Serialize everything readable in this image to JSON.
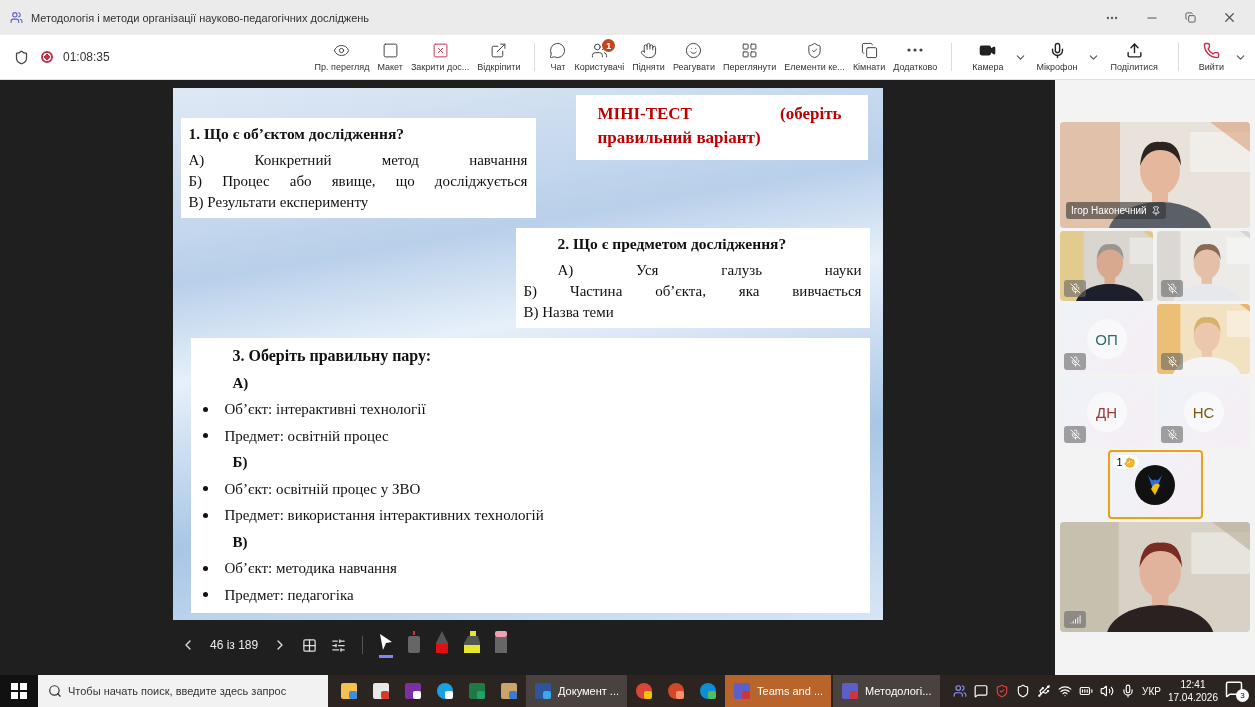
{
  "window": {
    "title": "Методологія і методи організації науково-педагогічних досліджень"
  },
  "meeting_bar": {
    "recording": true,
    "timer": "01:08:35",
    "buttons": [
      {
        "kind": "eye",
        "label": "Пр. перегляд"
      },
      {
        "kind": "layout",
        "label": "Макет"
      },
      {
        "kind": "stop",
        "label": "Закрити дос..."
      },
      {
        "kind": "popout",
        "label": "Відкріпити"
      },
      {
        "kind": "chat",
        "label": "Чат"
      },
      {
        "kind": "people",
        "label": "Користувачі",
        "badge": "1"
      },
      {
        "kind": "hand",
        "label": "Підняти"
      },
      {
        "kind": "react",
        "label": "Реагувати"
      },
      {
        "kind": "view",
        "label": "Переглянути"
      },
      {
        "kind": "controls",
        "label": "Елементи ке..."
      },
      {
        "kind": "rooms",
        "label": "Кімнати"
      },
      {
        "kind": "more",
        "label": "Додатково"
      }
    ],
    "devices": [
      {
        "kind": "camera",
        "label": "Камера",
        "dropdown": true
      },
      {
        "kind": "mic",
        "label": "Мікрофон",
        "dropdown": true
      },
      {
        "kind": "share",
        "label": "Поділитися",
        "dropdown": false
      },
      {
        "kind": "leave",
        "label": "Вийти",
        "dropdown": true
      }
    ]
  },
  "slide": {
    "title": "МІНІ-ТЕСТ (оберіть правильний варіант)",
    "questions": [
      {
        "title": "1. Що є об’єктом дослідження?",
        "options": [
          "А) Конкретний метод навчання",
          "Б) Процес або явище, що досліджується",
          "В) Результати експерименту"
        ]
      },
      {
        "title": "2. Що є предметом дослідження?",
        "options": [
          "А) Уся галузь науки",
          "Б) Частина об’єкта, яка вивчається",
          "В) Назва теми"
        ]
      }
    ],
    "pairs": {
      "title": "3. Оберіть правильну пару:",
      "groups": [
        {
          "label": "А)",
          "items": [
            "Об’єкт: інтерактивні технології",
            "Предмет: освітній процес"
          ]
        },
        {
          "label": "Б)",
          "items": [
            "Об’єкт: освітній процес у ЗВО",
            "Предмет: використання інтерактивних технологій"
          ]
        },
        {
          "label": "В)",
          "items": [
            "Об’єкт: методика навчання",
            "Предмет: педагогіка"
          ]
        }
      ]
    }
  },
  "slide_controls": {
    "page": "46 із 189",
    "tools": [
      {
        "kind": "pointer",
        "selected": true
      },
      {
        "kind": "laser",
        "selected": false
      },
      {
        "kind": "pen",
        "selected": false
      },
      {
        "kind": "highlighter",
        "selected": false
      },
      {
        "kind": "eraser",
        "selected": false
      }
    ]
  },
  "participants": [
    {
      "kind": "video",
      "name": "Ігор Наконечний",
      "pinned": true,
      "muted": false
    },
    {
      "kind": "video",
      "muted": true
    },
    {
      "kind": "video",
      "muted": true
    },
    {
      "kind": "initials",
      "initials": "ОП",
      "color": "#2f6b6b",
      "muted": true
    },
    {
      "kind": "video",
      "muted": true
    },
    {
      "kind": "initials",
      "initials": "ДН",
      "color": "#9c3a3a",
      "muted": true
    },
    {
      "kind": "initials",
      "initials": "НС",
      "color": "#7a5a12",
      "muted": true
    },
    {
      "kind": "avatar",
      "hand_count": "1",
      "highlighted": true,
      "muted": false
    },
    {
      "kind": "screen",
      "muted": false
    }
  ],
  "taskbar": {
    "search_placeholder": "Чтобы начать поиск, введите здесь запрос",
    "apps": [
      {
        "kind": "folder",
        "selected": false
      },
      {
        "kind": "app",
        "selected": false
      },
      {
        "kind": "note",
        "selected": false
      },
      {
        "kind": "skype",
        "selected": false
      },
      {
        "kind": "excel",
        "selected": false
      },
      {
        "kind": "paint",
        "selected": false
      },
      {
        "kind": "word",
        "label": "Документ ...",
        "selected": false
      },
      {
        "kind": "chrome",
        "selected": false
      },
      {
        "kind": "powerpoint",
        "selected": false
      },
      {
        "kind": "edge",
        "selected": false
      },
      {
        "kind": "teams",
        "label": "Teams and ...",
        "selected": true
      },
      {
        "kind": "teams",
        "label": "Методологі...",
        "selected": false
      }
    ],
    "language": "УКР",
    "time": "12:41",
    "date": "17.04.2026",
    "notifications": "3"
  }
}
